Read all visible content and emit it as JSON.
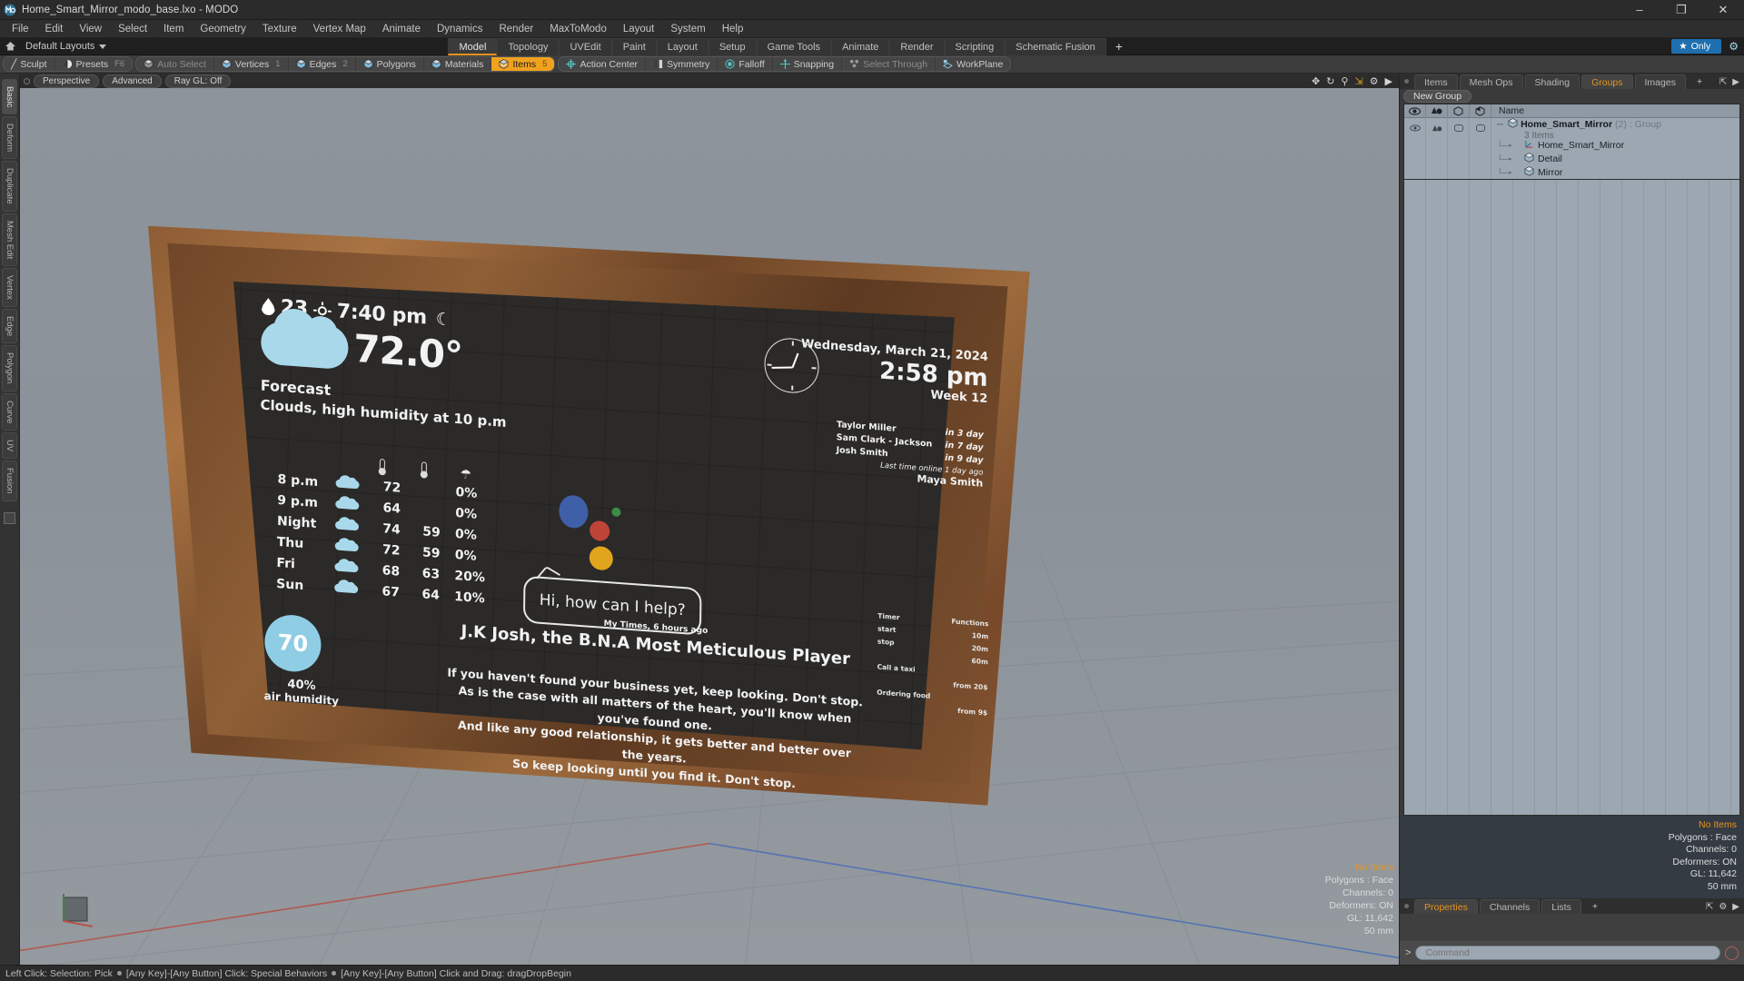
{
  "titlebar": {
    "title": "Home_Smart_Mirror_modo_base.lxo - MODO",
    "logo_icon": "modo-logo-icon",
    "minimize": "–",
    "maximize": "❐",
    "close": "✕"
  },
  "menubar": {
    "items": [
      "File",
      "Edit",
      "View",
      "Select",
      "Item",
      "Geometry",
      "Texture",
      "Vertex Map",
      "Animate",
      "Dynamics",
      "Render",
      "MaxToModo",
      "Layout",
      "System",
      "Help"
    ]
  },
  "layoutbar": {
    "home_icon": "home-icon",
    "layout_preset": "Default Layouts",
    "tabs": [
      {
        "label": "Model",
        "active": true
      },
      {
        "label": "Topology",
        "active": false
      },
      {
        "label": "UVEdit",
        "active": false
      },
      {
        "label": "Paint",
        "active": false
      },
      {
        "label": "Layout",
        "active": false
      },
      {
        "label": "Setup",
        "active": false
      },
      {
        "label": "Game Tools",
        "active": false
      },
      {
        "label": "Animate",
        "active": false
      },
      {
        "label": "Render",
        "active": false
      },
      {
        "label": "Scripting",
        "active": false
      },
      {
        "label": "Schematic Fusion",
        "active": false
      }
    ],
    "add_tab": "+",
    "only_label": "Only",
    "only_star_icon": "star-icon",
    "settings_icon": "gear-icon"
  },
  "modebar": {
    "groups": [
      {
        "buttons": [
          {
            "label": "Sculpt",
            "icon": "brush-icon",
            "state": "normal",
            "num": ""
          },
          {
            "label": "Presets",
            "icon": "sphere-icon",
            "state": "normal",
            "num": "F6"
          }
        ]
      },
      {
        "buttons": [
          {
            "label": "Auto Select",
            "icon": "cube-grey-icon",
            "state": "dim",
            "num": ""
          },
          {
            "label": "Vertices",
            "icon": "cube-vertices-icon",
            "state": "normal",
            "num": "1"
          },
          {
            "label": "Edges",
            "icon": "cube-edges-icon",
            "state": "normal",
            "num": "2"
          },
          {
            "label": "Polygons",
            "icon": "cube-polygons-icon",
            "state": "normal",
            "num": ""
          },
          {
            "label": "Materials",
            "icon": "cube-materials-icon",
            "state": "normal",
            "num": ""
          },
          {
            "label": "Items",
            "icon": "cube-items-icon",
            "state": "active",
            "num": "5"
          }
        ]
      },
      {
        "buttons": [
          {
            "label": "Action Center",
            "icon": "action-center-icon",
            "state": "normal",
            "num": ""
          },
          {
            "label": "Symmetry",
            "icon": "symmetry-icon",
            "state": "normal",
            "num": ""
          },
          {
            "label": "Falloff",
            "icon": "falloff-icon",
            "state": "normal",
            "num": ""
          },
          {
            "label": "Snapping",
            "icon": "snapping-icon",
            "state": "normal",
            "num": ""
          },
          {
            "label": "Select Through",
            "icon": "select-through-icon",
            "state": "dim",
            "num": ""
          },
          {
            "label": "WorkPlane",
            "icon": "workplane-icon",
            "state": "normal",
            "num": ""
          }
        ]
      }
    ]
  },
  "leftrail": {
    "tabs": [
      "Basic",
      "Deform",
      "Duplicate",
      "Mesh Edit",
      "Vertex",
      "Edge",
      "Polygon",
      "Curve",
      "UV",
      "Fusion"
    ]
  },
  "viewport": {
    "header": {
      "dot_icon": "viewport-menu-dot-icon",
      "pills": [
        "Perspective",
        "Advanced",
        "Ray GL: Off"
      ],
      "icons": [
        "move-icon",
        "rotate-icon",
        "zoom-icon",
        "fit-icon",
        "gear-icon",
        "chevron-right-icon"
      ]
    },
    "status": {
      "selection": "No Items",
      "polygons": "Polygons : Face",
      "channels": "Channels: 0",
      "deformers": "Deformers: ON",
      "gl": "GL: 11,642",
      "units": "50 mm"
    }
  },
  "mirror": {
    "weather_top": {
      "humidity_value": "23",
      "sunset_time": "7:40 pm",
      "drop_icon": "water-drop-icon",
      "sun_icon": "sun-icon",
      "moon_icon": "moon-icon"
    },
    "current": {
      "temperature": "72.0°",
      "cloud_icon": "cloud-icon"
    },
    "forecast_heading": "Forecast",
    "forecast_summary": "Clouds, high humidity at 10 p.m",
    "forecast_table": {
      "col_icons": [
        "thermometer-high-icon",
        "thermometer-low-icon",
        "umbrella-icon"
      ],
      "rows": [
        {
          "day": "8 p.m",
          "icon": "cloud-icon",
          "high": "72",
          "low": "",
          "precip": "0%"
        },
        {
          "day": "9 p.m",
          "icon": "cloud-icon",
          "high": "64",
          "low": "",
          "precip": "0%"
        },
        {
          "day": "Night",
          "icon": "cloud-icon",
          "high": "74",
          "low": "59",
          "precip": "0%"
        },
        {
          "day": "Thu",
          "icon": "cloud-icon",
          "high": "72",
          "low": "59",
          "precip": "0%"
        },
        {
          "day": "Fri",
          "icon": "cloud-icon",
          "high": "68",
          "low": "63",
          "precip": "20%"
        },
        {
          "day": "Sun",
          "icon": "cloud-icon",
          "high": "67",
          "low": "64",
          "precip": "10%"
        }
      ]
    },
    "humidity_widget": {
      "value": "70",
      "percent": "40%",
      "label": "air humidity"
    },
    "datetime": {
      "date": "Wednesday, March 21, 2024",
      "time": "2:58 pm",
      "week": "Week 12",
      "clock_icon": "analog-clock-icon"
    },
    "people": {
      "names": [
        "Taylor Miller",
        "Sam Clark - Jackson",
        "Josh Smith"
      ],
      "whens": [
        "in 3 day",
        "in 7 day",
        "in 9 day"
      ],
      "last_seen_label": "Last time online 1 day ago",
      "last_seen_name": "Maya Smith"
    },
    "assistant": {
      "dots": [
        "blue",
        "red",
        "green",
        "yellow"
      ],
      "bubble_text": "Hi, how can I help?"
    },
    "quote": {
      "meta": "My Times, 6 hours ago",
      "title": "J.K Josh, the B.N.A Most Meticulous Player",
      "body_lines": [
        "If you haven't found your business yet, keep looking. Don't stop.",
        "As is the case with all matters of the heart, you'll know when you've found one.",
        "And like any good relationship, it gets better and better over the years.",
        "So keep looking until you find it. Don't stop."
      ]
    },
    "mini_panel": {
      "col1": [
        "Timer",
        "start",
        "stop",
        "",
        "Call a taxi",
        "",
        "Ordering food"
      ],
      "col2": [
        "Functions",
        "10m",
        "20m",
        "60m",
        "",
        "from 20$",
        "",
        "from 9$"
      ]
    }
  },
  "rightpanel": {
    "tabs": [
      {
        "label": "Items",
        "active": false
      },
      {
        "label": "Mesh Ops",
        "active": false
      },
      {
        "label": "Shading",
        "active": false
      },
      {
        "label": "Groups",
        "active": true
      },
      {
        "label": "Images",
        "active": false
      }
    ],
    "add_tab": "+",
    "new_group_button": "New Group",
    "columns": {
      "visibility_icon": "eye-icon",
      "render_icon": "render-visibility-icon",
      "wire_icon": "wireframe-icon",
      "shade_icon": "shaded-icon",
      "name": "Name"
    },
    "tree": [
      {
        "type": "group",
        "name": "Home_Smart_Mirror",
        "count": "(2)",
        "kind": ": Group",
        "sub": "3 Items",
        "icon": "group-cube-icon"
      },
      {
        "type": "child",
        "name": "Home_Smart_Mirror",
        "icon": "locator-icon"
      },
      {
        "type": "child",
        "name": "Detail",
        "icon": "mesh-cube-icon"
      },
      {
        "type": "child",
        "name": "Mirror",
        "icon": "mesh-cube-icon"
      }
    ],
    "bottom_tabs": [
      {
        "label": "Properties",
        "active": true
      },
      {
        "label": "Channels",
        "active": false
      },
      {
        "label": "Lists",
        "active": false
      }
    ],
    "bottom_add_tab": "+",
    "command": {
      "prompt": ">",
      "placeholder": "Command",
      "record_icon": "record-icon"
    }
  },
  "statusbar": {
    "text_parts": [
      "Left Click: Selection: Pick",
      "[Any Key]-[Any Button] Click: Special Behaviors",
      "[Any Key]-[Any Button] Click and Drag: dragDropBegin"
    ]
  },
  "colors": {
    "accent_orange": "#e8941f",
    "accent_blue": "#1f6fae",
    "panel_bg": "#3a3a3a",
    "list_bg": "#9ca7b2",
    "mirror_screen": "#2b2a28",
    "cloud_blue": "#a8d8ea"
  }
}
